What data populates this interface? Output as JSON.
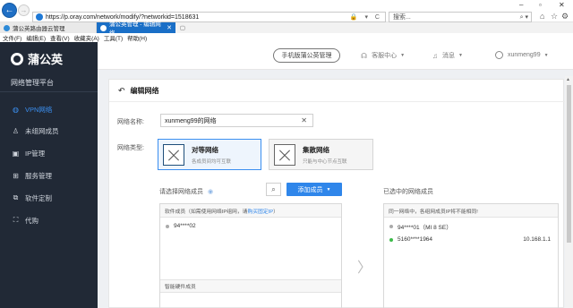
{
  "browser": {
    "url": "https://p.oray.com/network/modify/?networkid=1518631",
    "search_placeholder": "搜索...",
    "tabs": [
      {
        "label": "蒲公英路由器云管理"
      },
      {
        "label": "蒲公英管理 - 编辑网络"
      }
    ],
    "menu": [
      "文件(F)",
      "编辑(E)",
      "查看(V)",
      "收藏夹(A)",
      "工具(T)",
      "帮助(H)"
    ]
  },
  "app": {
    "logo_text": "蒲公英",
    "platform_title": "网络管理平台",
    "nav": [
      {
        "label": "VPN网络",
        "icon": "globe-icon",
        "active": true
      },
      {
        "label": "未组网成员",
        "icon": "person-icon"
      },
      {
        "label": "IP管理",
        "icon": "ip-icon"
      },
      {
        "label": "服务管理",
        "icon": "grid-icon"
      },
      {
        "label": "软件定制",
        "icon": "puzzle-icon"
      },
      {
        "label": "代购",
        "icon": "cart-icon"
      }
    ],
    "topbar": {
      "mobile_btn": "手机版蒲公英管理",
      "service": "客服中心",
      "messages": "消息",
      "user": "xunmeng99"
    }
  },
  "page": {
    "title": "编辑网络",
    "name_label": "网络名称:",
    "name_value": "xunmeng99的网络",
    "type_label": "网络类型:",
    "types": [
      {
        "title": "对等网络",
        "sub": "各成员间均可互联",
        "selected": true
      },
      {
        "title": "集散网络",
        "sub": "只能与中心节点互联",
        "selected": false
      }
    ],
    "select_members_label": "请选择网络成员",
    "add_member_btn": "添加成员",
    "selected_members_label": "已选中的网络成员",
    "software_head_pre": "软件成员（如需使用网络IP组网，请",
    "software_head_link": "购买固定IP",
    "software_head_post": "）",
    "left_members": [
      {
        "name": "94****02",
        "status": "gray"
      }
    ],
    "hardware_head": "智能硬件成员",
    "right_head": "同一网络中，各组网成员IP将不能相同!",
    "right_members": [
      {
        "name": "94****01（MI 8 SE）",
        "status": "gray",
        "ip": ""
      },
      {
        "name": "5160****1964",
        "status": "green",
        "ip": "10.168.1.1"
      }
    ]
  },
  "colors": {
    "sidebar_bg": "#212936",
    "accent": "#2f86ea",
    "tab_active": "#1a6fc7"
  }
}
